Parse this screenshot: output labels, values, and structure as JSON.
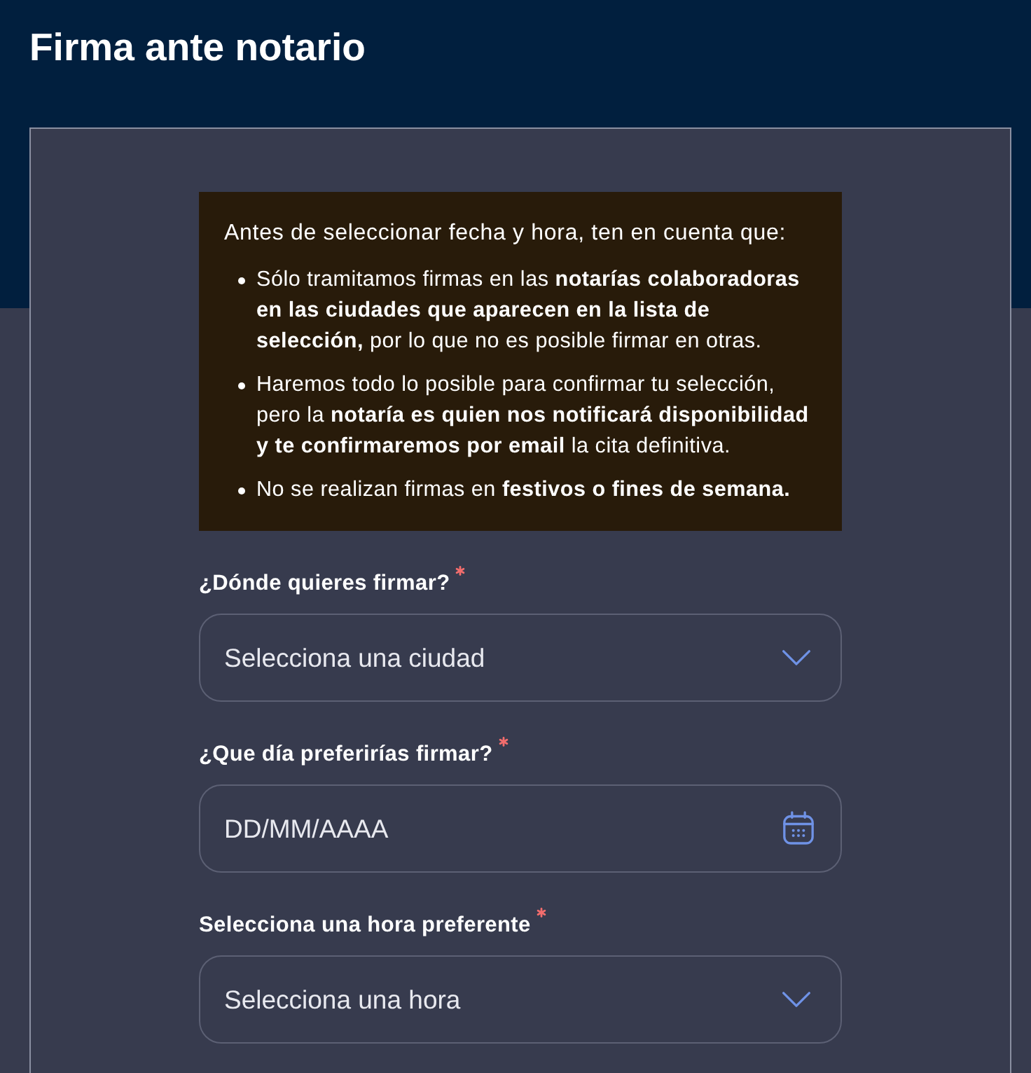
{
  "page": {
    "title": "Firma ante notario"
  },
  "notice": {
    "intro": "Antes de seleccionar fecha y hora, ten en cuenta que:",
    "items": [
      "Sólo tramitamos firmas en las **notarías colaboradoras en las ciudades que aparecen en la lista de selección,** por lo que no es posible firmar en otras.",
      "Haremos todo lo posible para confirmar tu selección, pero la **notaría es quien nos notificará disponibilidad y te confirmaremos por email** la cita definitiva.",
      "No se realizan firmas en **festivos o fines de semana.**"
    ]
  },
  "fields": [
    {
      "kind": "select",
      "label": "¿Dónde quieres firmar?",
      "required": true,
      "placeholder": "Selecciona una ciudad"
    },
    {
      "kind": "date",
      "label": "¿Que día preferirías firmar?",
      "required": true,
      "placeholder": "DD/MM/AAAA"
    },
    {
      "kind": "select",
      "label": "Selecciona una hora preferente",
      "required": true,
      "placeholder": "Selecciona una hora"
    }
  ]
}
